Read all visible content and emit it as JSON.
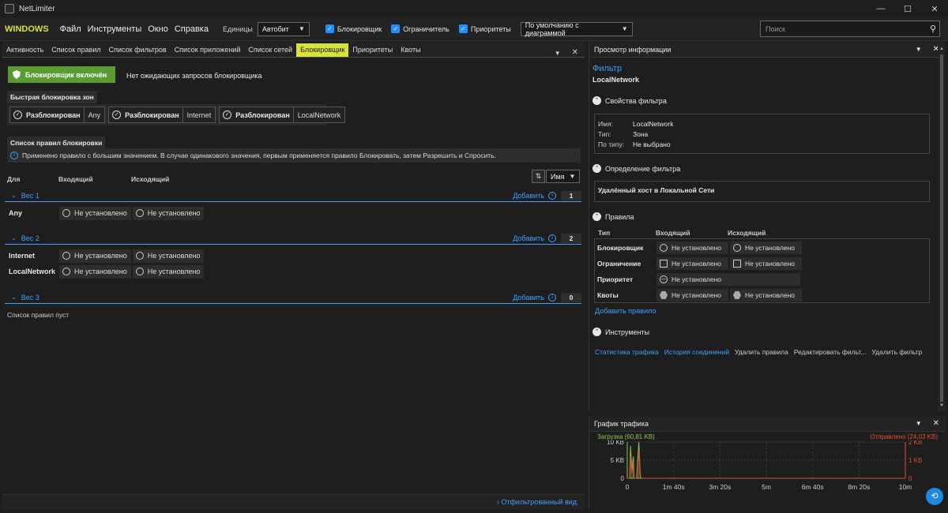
{
  "window": {
    "title": "NetLimiter",
    "controls": [
      "—",
      "☐",
      "✕"
    ]
  },
  "menubar": {
    "brand": "WINDOWS",
    "menus": [
      "Файл",
      "Инструменты",
      "Окно",
      "Справка"
    ],
    "units_label": "Единицы",
    "units_value": "Автобит",
    "checks": [
      "Блокировщик",
      "Ограничитель",
      "Приоритеты"
    ],
    "preset_value": "По умолчанию с диаграммой",
    "search_placeholder": "Поиск"
  },
  "left_tabs": [
    "Активность",
    "Список правил",
    "Список фильтров",
    "Список приложений",
    "Список сетей",
    "Блокировщик",
    "Приоритеты",
    "Квоты"
  ],
  "active_tab_index": 5,
  "blocker": {
    "status_badge": "Блокировщик включён",
    "pending_text": "Нет ожидающих запросов блокировщика",
    "zones_header": "Быстрая блокировка зон",
    "zones": [
      {
        "state": "Разблокирован",
        "name": "Any"
      },
      {
        "state": "Разблокирован",
        "name": "Internet"
      },
      {
        "state": "Разблокирован",
        "name": "LocalNetwork"
      }
    ],
    "rules_header": "Список правил блокировки",
    "info_text": "Применено правило с большим значением. В случае одинакового значения, первым применяется правило Блокировать, затем Разрешить и Спросить.",
    "columns": [
      "Для",
      "Входящий",
      "Исходящий"
    ],
    "sort_value": "Имя",
    "groups": [
      {
        "name": "Вес 1",
        "add": "Добавить",
        "count": "1",
        "rows": [
          {
            "name": "Any",
            "in": "Не установлено",
            "out": "Не установлено"
          }
        ]
      },
      {
        "name": "Вес 2",
        "add": "Добавить",
        "count": "2",
        "rows": [
          {
            "name": "Internet",
            "in": "Не установлено",
            "out": "Не установлено"
          },
          {
            "name": "LocalNetwork",
            "in": "Не установлено",
            "out": "Не установлено"
          }
        ]
      },
      {
        "name": "Вес 3",
        "add": "Добавить",
        "count": "0",
        "rows": []
      }
    ],
    "empty_text": "Список правил пуст",
    "filtered_view": "Отфильтрованный вид"
  },
  "info_panel": {
    "header": "Просмотр информации",
    "filter_title": "Фильтр",
    "filter_name": "LocalNetwork",
    "props_header": "Свойства фильтра",
    "props": [
      {
        "k": "Имя:",
        "v": "LocalNetwork"
      },
      {
        "k": "Тип:",
        "v": "Зона"
      },
      {
        "k": "По типу:",
        "v": "Не выбрано"
      }
    ],
    "def_header": "Определение фильтра",
    "def_text": "Удалённый хост в Локальной Сети",
    "rules_header": "Правила",
    "rule_cols": [
      "Тип",
      "Входящий",
      "Исходящий"
    ],
    "rules": [
      {
        "name": "Блокировщик",
        "in": "Не установлено",
        "out": "Не установлено"
      },
      {
        "name": "Ограничение",
        "in": "Не установлено",
        "out": "Не установлено"
      },
      {
        "name": "Приоритет",
        "in": "Не установлено"
      },
      {
        "name": "Квоты",
        "in": "Не установлено",
        "out": "Не установлено"
      }
    ],
    "add_rule": "Добавить правило",
    "tools_header": "Инструменты",
    "tools": [
      "Статистика трафика",
      "История соединений",
      "Удалить правила",
      "Редактировать фильт...",
      "Удалить фильтр"
    ]
  },
  "graph": {
    "header": "График трафика",
    "download_legend": "Загрузка (60,81 KB)",
    "upload_legend": "Отправлено (24,03 KB)"
  },
  "colors": {
    "accent": "#d7e23a",
    "link": "#3ea0ff",
    "enabled": "#5a9b34",
    "download": "#8bc34a",
    "upload": "#e05030"
  },
  "chart_data": {
    "type": "line",
    "x_tick_labels": [
      "0",
      "1m 40s",
      "3m 20s",
      "5m",
      "6m 40s",
      "8m 20s",
      "10m"
    ],
    "y_left_labels": [
      "0",
      "5 KB",
      "10 KB"
    ],
    "y_right_labels": [
      "0",
      "1 KB",
      "2 KB"
    ],
    "series": [
      {
        "name": "Загрузка (60,81 KB)",
        "x_seconds": [
          0,
          5,
          7,
          10,
          13,
          15,
          20,
          25,
          28,
          30,
          35,
          600
        ],
        "values_kb": [
          0,
          0,
          9,
          2,
          6,
          0,
          0,
          11,
          1,
          0,
          0,
          0
        ]
      },
      {
        "name": "Отправлено (24,03 KB)",
        "x_seconds": [
          0,
          5,
          7,
          10,
          13,
          15,
          20,
          25,
          28,
          30,
          35,
          600
        ],
        "values_kb": [
          0,
          0,
          1.2,
          0.3,
          0.8,
          0,
          0,
          1.5,
          0.2,
          0,
          0,
          0
        ]
      }
    ],
    "ylim_left": [
      0,
      10
    ],
    "ylim_right": [
      0,
      2
    ],
    "xlim_seconds": [
      0,
      600
    ]
  }
}
